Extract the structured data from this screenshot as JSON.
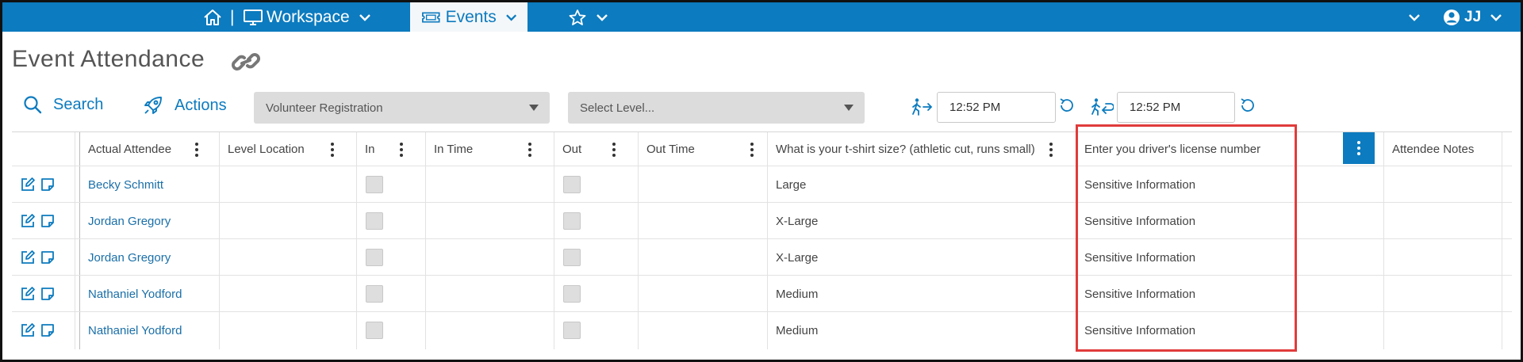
{
  "nav": {
    "separator": "|",
    "workspace_label": "Workspace",
    "events_label": "Events",
    "user_initials": "JJ"
  },
  "page": {
    "title": "Event Attendance"
  },
  "toolbar": {
    "search_label": "Search",
    "actions_label": "Actions",
    "registration_select": "Volunteer Registration",
    "level_select": "Select Level...",
    "checkin_time": "12:52 PM",
    "checkout_time": "12:52 PM"
  },
  "table": {
    "columns": [
      "Actual Attendee",
      "Level Location",
      "In",
      "In Time",
      "Out",
      "Out Time",
      "What is your t-shirt size? (athletic cut, runs small)",
      "Enter you driver's license number",
      "Attendee Notes"
    ],
    "rows": [
      {
        "attendee": "Becky Schmitt",
        "level_location": "",
        "in_time": "",
        "out_time": "",
        "tshirt": "Large",
        "license": "Sensitive Information",
        "notes": ""
      },
      {
        "attendee": "Jordan Gregory",
        "level_location": "",
        "in_time": "",
        "out_time": "",
        "tshirt": "X-Large",
        "license": "Sensitive Information",
        "notes": ""
      },
      {
        "attendee": "Jordan Gregory",
        "level_location": "",
        "in_time": "",
        "out_time": "",
        "tshirt": "X-Large",
        "license": "Sensitive Information",
        "notes": ""
      },
      {
        "attendee": "Nathaniel Yodford",
        "level_location": "",
        "in_time": "",
        "out_time": "",
        "tshirt": "Medium",
        "license": "Sensitive Information",
        "notes": ""
      },
      {
        "attendee": "Nathaniel Yodford",
        "level_location": "",
        "in_time": "",
        "out_time": "",
        "tshirt": "Medium",
        "license": "Sensitive Information",
        "notes": ""
      }
    ]
  },
  "colors": {
    "brand_blue": "#0c7bbf",
    "highlight_red": "#e03b3b"
  },
  "icons": [
    "home-icon",
    "monitor-icon",
    "ticket-icon",
    "star-icon",
    "user-circle-icon",
    "chevron-down-icon",
    "link-icon",
    "search-icon",
    "rocket-icon",
    "check-in-icon",
    "check-out-icon",
    "reset-icon",
    "edit-icon",
    "note-icon",
    "kebab-menu-icon"
  ]
}
